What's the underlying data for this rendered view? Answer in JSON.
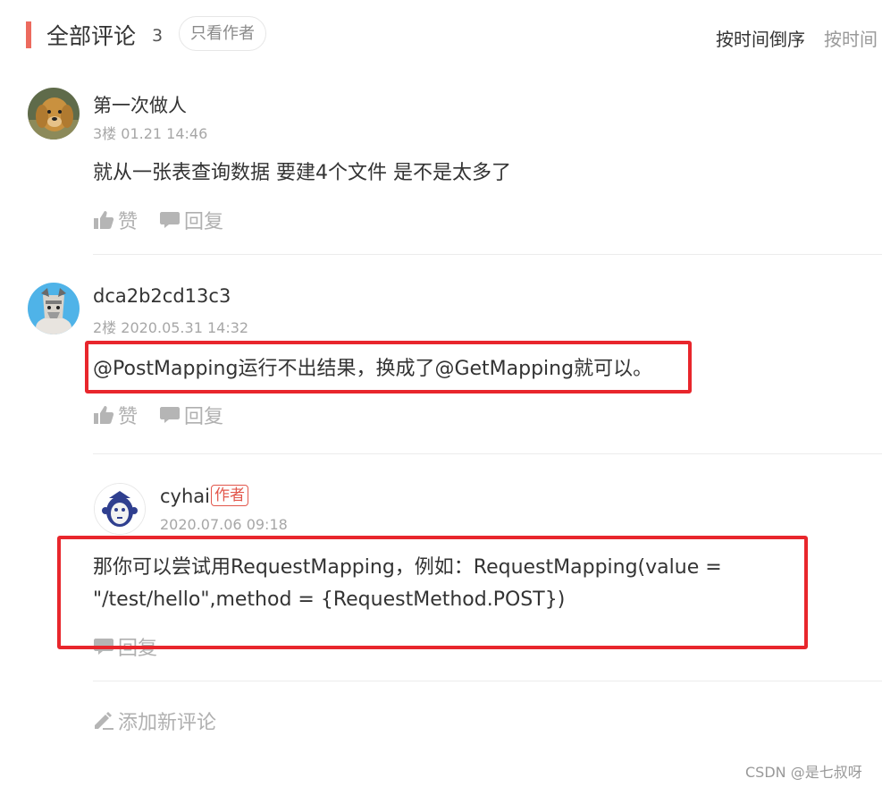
{
  "header": {
    "title": "全部评论",
    "count": "3",
    "filter_label": "只看作者",
    "sort_desc": "按时间倒序",
    "sort_asc": "按时间"
  },
  "comments": [
    {
      "username": "第一次做人",
      "floor_time": "3楼 01.21 14:46",
      "content": "就从一张表查询数据 要建4个文件 是不是太多了",
      "like_label": "赞",
      "reply_label": "回复"
    },
    {
      "username": "dca2b2cd13c3",
      "floor_time": "2楼 2020.05.31 14:32",
      "content": "@PostMapping运行不出结果，换成了@GetMapping就可以。",
      "like_label": "赞",
      "reply_label": "回复"
    }
  ],
  "reply": {
    "username": "cyhai",
    "author_badge": "作者",
    "time": "2020.07.06 09:18",
    "content_line1": "那你可以尝试用RequestMapping，例如：RequestMapping(value =",
    "content_line2": "\"/test/hello\",method = {RequestMethod.POST})",
    "reply_label": "回复"
  },
  "add_comment_label": "添加新评论",
  "watermark": "CSDN @是七叔呀",
  "colors": {
    "accent_bar": "#ec6a5e",
    "annotation_box": "#e8262c",
    "author_badge": "#e2574c"
  }
}
